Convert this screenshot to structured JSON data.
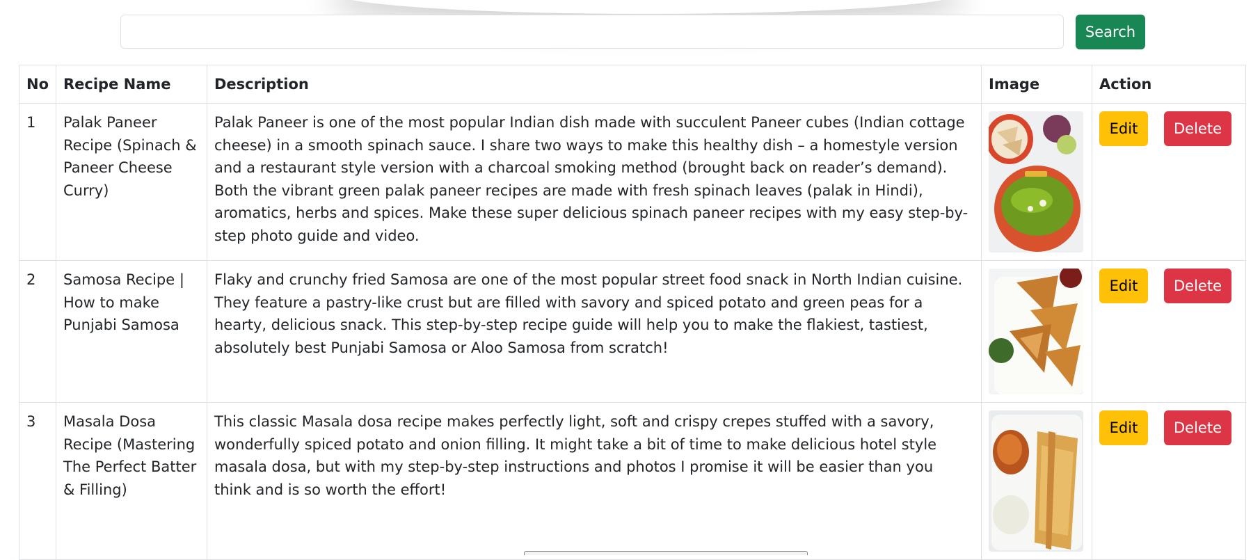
{
  "search": {
    "placeholder": "",
    "value": "",
    "button_label": "Search"
  },
  "table": {
    "headers": {
      "no": "No",
      "name": "Recipe Name",
      "description": "Description",
      "image": "Image",
      "action": "Action"
    },
    "rows": [
      {
        "no": "1",
        "name": "Palak Paneer Recipe (Spinach & Paneer Cheese Curry)",
        "description": "Palak Paneer is one of the most popular Indian dish made with succulent Paneer cubes (Indian cottage cheese) in a smooth spinach sauce. I share two ways to make this healthy dish – a homestyle version and a restaurant style version with a charcoal smoking method (brought back on reader’s demand). Both the vibrant green palak paneer recipes are made with fresh spinach leaves (palak in Hindi), aromatics, herbs and spices. Make these super delicious spinach paneer recipes with my easy step-by-step photo guide and video.",
        "image": "palak-paneer-photo",
        "edit_label": "Edit",
        "delete_label": "Delete"
      },
      {
        "no": "2",
        "name": "Samosa Recipe | How to make Punjabi Samosa",
        "description": "Flaky and crunchy fried Samosa are one of the most popular street food snack in North Indian cuisine. They feature a pastry-like crust but are filled with savory and spiced potato and green peas for a hearty, delicious snack. This step-by-step recipe guide will help you to make the flakiest, tastiest, absolutely best Punjabi Samosa or Aloo Samosa from scratch!",
        "image": "samosa-photo",
        "edit_label": "Edit",
        "delete_label": "Delete"
      },
      {
        "no": "3",
        "name": "Masala Dosa Recipe (Mastering The Perfect Batter & Filling)",
        "description": "This classic Masala dosa recipe makes perfectly light, soft and crispy crepes stuffed with a savory, wonderfully spiced potato and onion filling. It might take a bit of time to make delicious hotel style masala dosa, but with my step-by-step instructions and photos I promise it will be easier than you think and is so worth the effort!",
        "image": "masala-dosa-photo",
        "edit_label": "Edit",
        "delete_label": "Delete"
      }
    ]
  },
  "colors": {
    "search_button": "#198754",
    "edit_button": "#ffc107",
    "delete_button": "#dc3545",
    "border": "#dee2e6"
  }
}
